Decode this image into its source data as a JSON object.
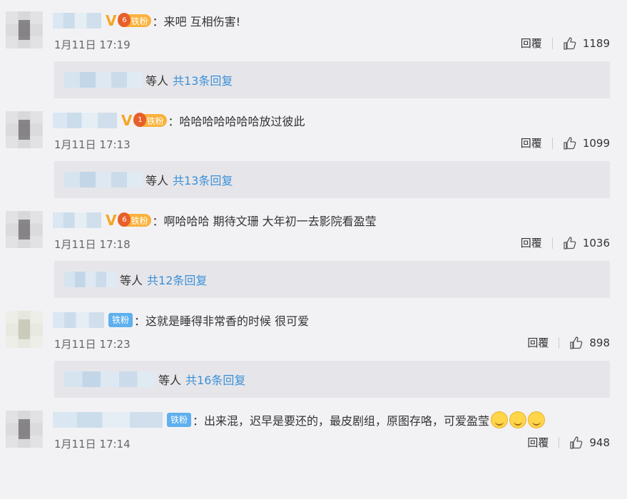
{
  "comments": [
    {
      "badge": "铁粉",
      "badge_level": "6",
      "verified": "V",
      "text": "：来吧 互相伤害!",
      "time": "1月11日 17:19",
      "reply_label": "回覆",
      "likes": "1189",
      "replies_who": "等人",
      "replies_count": "共13条回复"
    },
    {
      "badge": "铁粉",
      "badge_level": "1",
      "verified": "V",
      "text": "：哈哈哈哈哈哈哈放过彼此",
      "time": "1月11日 17:13",
      "reply_label": "回覆",
      "likes": "1099",
      "replies_who": "等人",
      "replies_count": "共13条回复"
    },
    {
      "badge": "铁粉",
      "badge_level": "6",
      "verified": "V",
      "text": "：啊哈哈哈 期待文珊 大年初一去影院看盈莹",
      "time": "1月11日 17:18",
      "reply_label": "回覆",
      "likes": "1036",
      "replies_who": "等人",
      "replies_count": "共12条回复"
    },
    {
      "badge": "铁粉",
      "text": "：这就是睡得非常香的时候 很可爱",
      "time": "1月11日 17:23",
      "reply_label": "回覆",
      "likes": "898",
      "replies_who": "等人",
      "replies_count": "共16条回复"
    },
    {
      "badge": "铁粉",
      "text": "：出来混，迟早是要还的，最皮剧组，原图存咯，可爱盈莹",
      "time": "1月11日 17:14",
      "reply_label": "回覆",
      "likes": "948"
    }
  ],
  "colors": {
    "link": "#3b8fd6",
    "fan_badge": "#f9b23b",
    "tie_badge": "#5eb0ee",
    "verified": "#f5a623"
  },
  "icons": {
    "like": "thumbs-up-icon",
    "emoji": "laughing-face-icon"
  }
}
